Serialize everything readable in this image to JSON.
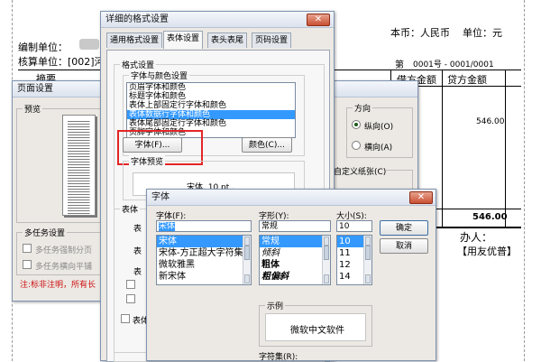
{
  "voucher": {
    "currency": "本币：人民币",
    "unit": "单位：元",
    "label_company": "编制单位：",
    "label_book": "核算单位：[002]河",
    "doc_prefix": "第",
    "doc_number": "0001号 - 0001/0001",
    "col_summary": "摘要",
    "col_debit": "借方金额",
    "col_credit": "贷方金额",
    "amount_1": "546.00",
    "total": "546.00",
    "handler": "办人：",
    "sign": "【用友优普】"
  },
  "page_setup": {
    "title": "页面设置",
    "preview_label": "预览",
    "direction_group": "方向",
    "portrait": "纵向(O)",
    "landscape": "横向(A)",
    "custom_paper": "自定义纸张(C)",
    "multitask_group": "多任务设置",
    "multitask_opt1": "多任务强制分页",
    "multitask_opt2": "多任务横向平铺",
    "note": "注:标非注明，所有长"
  },
  "format_dialog": {
    "title": "详细的格式设置",
    "close": "✕",
    "tabs": [
      "通用格式设置",
      "表体设置",
      "表头表尾",
      "页码设置"
    ],
    "format_group": "格式设置",
    "font_color_group": "字体与颜色设置",
    "font_items": [
      "页眉字体和颜色",
      "标题字体和颜色",
      "表体上部固定行字体和颜色",
      "表体数据行字体和颜色",
      "表体尾部固定行字体和颜色",
      "页脚字体和颜色"
    ],
    "font_button": "字体(F)...",
    "color_button": "颜色(C)...",
    "preview_group": "字体预览",
    "preview_text": "宋体, 10 pt,,",
    "body_group": "表体",
    "body_row_1": "表",
    "body_row_2": "表",
    "body_row_3": "表",
    "body_row_4": "表体"
  },
  "font_dialog": {
    "title": "字体",
    "close": "✕",
    "font_label": "字体(F):",
    "style_label": "字形(Y):",
    "size_label": "大小(S):",
    "font_value": "宋体",
    "style_value": "常规",
    "size_value": "10",
    "fonts": [
      "宋体",
      "宋体-方正超大字符集",
      "微软雅黑",
      "新宋体"
    ],
    "styles": [
      "常规",
      "倾斜",
      "粗体",
      "粗偏斜"
    ],
    "sizes": [
      "10",
      "11",
      "12",
      "14"
    ],
    "ok": "确定",
    "cancel": "取消",
    "sample_group": "示例",
    "sample_text": "微软中文软件",
    "charset_label": "字符集(R):"
  },
  "colors": {
    "highlight": "#3399ff",
    "annotation": "#e32626",
    "note": "#cc1010",
    "dialog_bg": "#ece9e4"
  }
}
